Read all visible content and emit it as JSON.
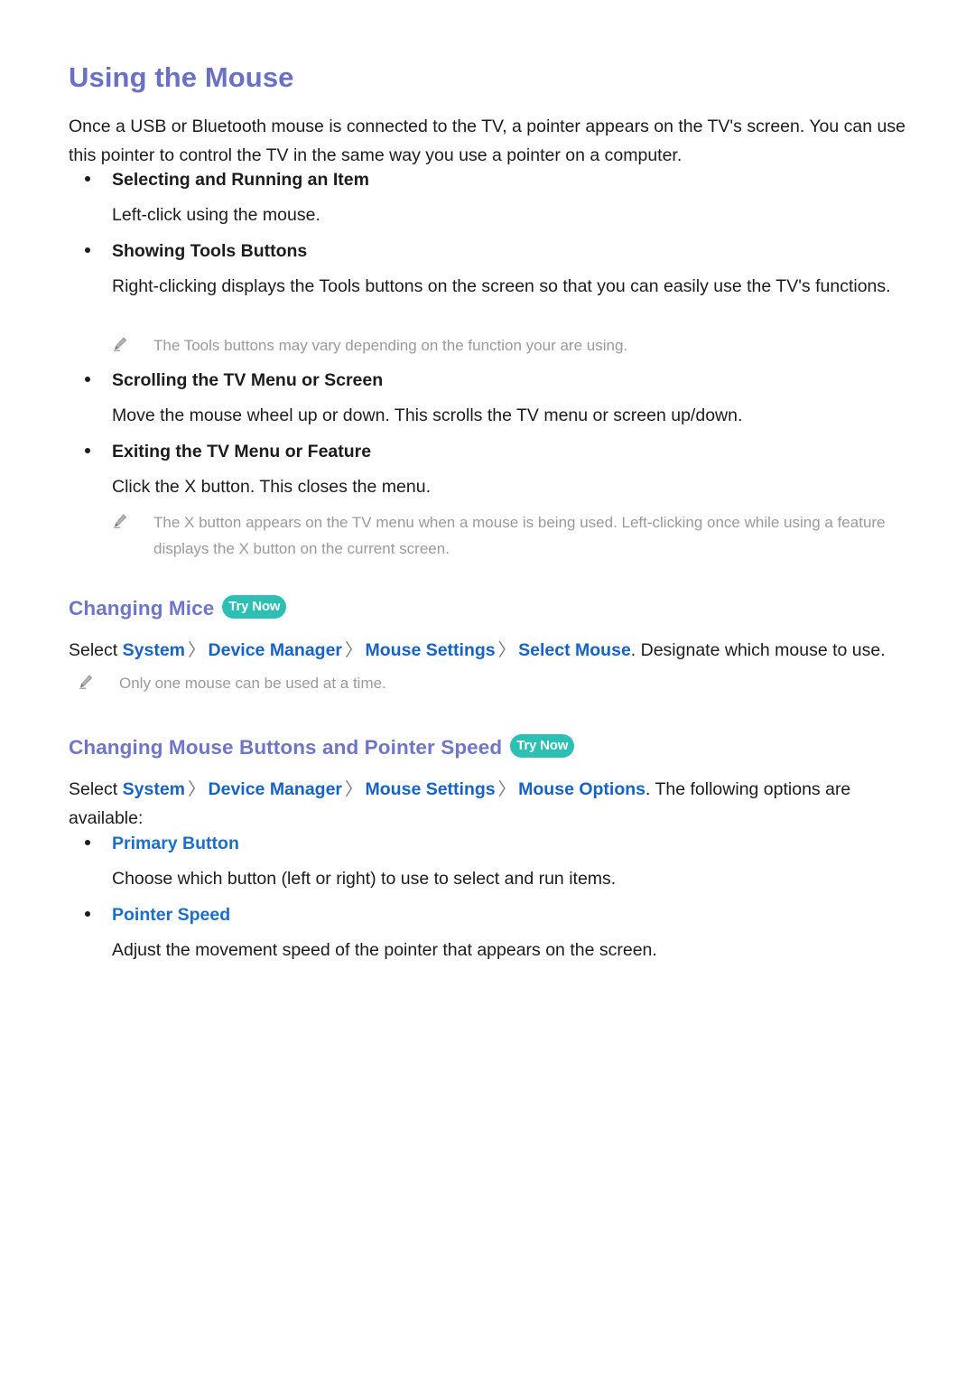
{
  "document": {
    "title": "Using the Mouse",
    "intro": "Once a USB or Bluetooth mouse is connected to the TV, a pointer appears on the TV's screen. You can use this pointer to control the TV in the same way you use a pointer on a computer.",
    "accent_heading_color": "#6a70c4",
    "link_color": "#1763c4",
    "badge_color": "#2ebfb4",
    "note_color": "#9a9a9a"
  },
  "sections": {
    "mouse_actions": {
      "items": [
        {
          "label": "Selecting and Running an Item",
          "body": "Left-click using the mouse."
        },
        {
          "label": "Showing Tools Buttons",
          "body": "Right-clicking displays the Tools buttons on the screen so that you can easily use the TV's functions.",
          "note": "The Tools buttons may vary depending on the function your are using."
        },
        {
          "label": "Scrolling the TV Menu or Screen",
          "body": "Move the mouse wheel up or down. This scrolls the TV menu or screen up/down."
        },
        {
          "label": "Exiting the TV Menu or Feature",
          "body": "Click the X button. This closes the menu.",
          "note": "The X button appears on the TV menu when a mouse is being used. Left-clicking once while using a feature displays the X button on the current screen."
        }
      ]
    },
    "changing_mice": {
      "heading": "Changing Mice",
      "badge": "Try Now",
      "select_prefix": "Select",
      "breadcrumb": [
        "System",
        "Device Manager",
        "Mouse Settings",
        "Select Mouse"
      ],
      "separator": "〉",
      "select_suffix": ". Designate which mouse to use.",
      "note": "Only one mouse can be used at a time."
    },
    "changing_mouse_buttons": {
      "heading": "Changing Mouse Buttons and Pointer Speed",
      "badge": "Try Now",
      "select_prefix": "Select",
      "breadcrumb": [
        "System",
        "Device Manager",
        "Mouse Settings",
        "Mouse Options"
      ],
      "separator": "〉",
      "select_suffix": ". The following options are available:",
      "options": [
        {
          "label": "Primary Button",
          "body": "Choose which button (left or right) to use to select and run items."
        },
        {
          "label": "Pointer Speed",
          "body": "Adjust the movement speed of the pointer that appears on the screen."
        }
      ]
    }
  },
  "icons": {
    "note_icon": "pencil-icon",
    "bullet_icon": "bullet-dot-icon"
  }
}
